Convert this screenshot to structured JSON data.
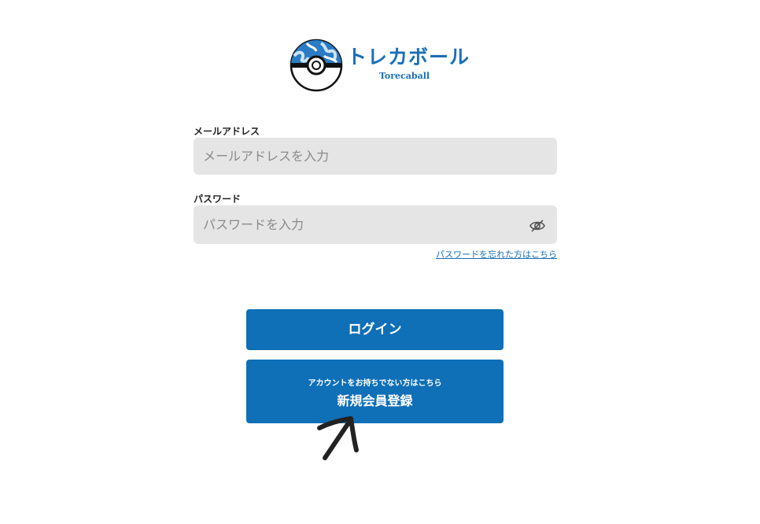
{
  "logo": {
    "title": "トレカボール",
    "subtitle": "Torecaball",
    "icon": "pokeball-icon"
  },
  "email": {
    "label": "メールアドレス",
    "placeholder": "メールアドレスを入力",
    "value": ""
  },
  "password": {
    "label": "パスワード",
    "placeholder": "パスワードを入力",
    "value": "",
    "toggle_icon": "eye-off-icon"
  },
  "forgot_password": "パスワードを忘れた方はこちら",
  "login_button": "ログイン",
  "register_button": {
    "caption": "アカウントをお持ちでない方はこちら",
    "label": "新規会員登録"
  },
  "annotation": {
    "icon": "hand-drawn-arrow-icon"
  },
  "colors": {
    "brand": "#1a6fb8",
    "button": "#0f6fb7",
    "field_bg": "#e5e5e5"
  }
}
